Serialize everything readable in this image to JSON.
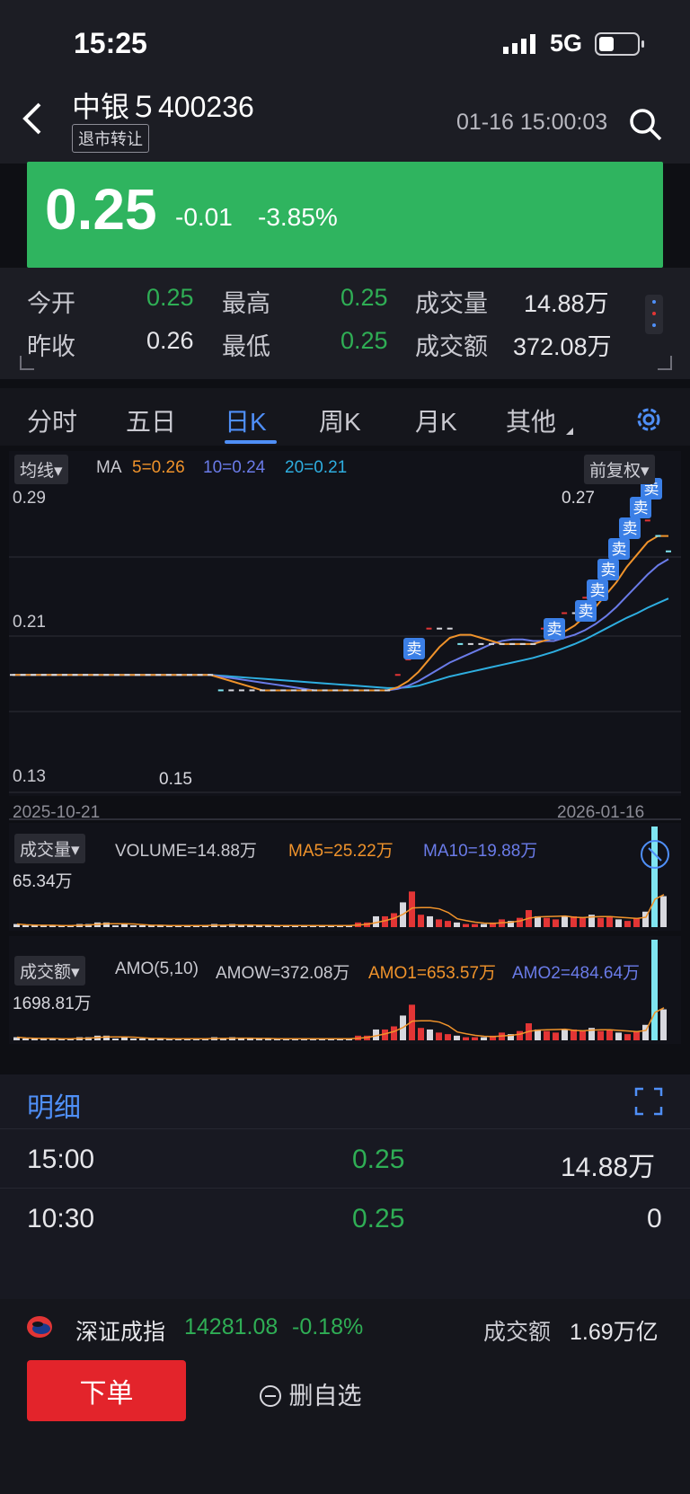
{
  "status": {
    "time": "15:25",
    "network": "5G"
  },
  "header": {
    "name": "中银５400236",
    "tag": "退市转让",
    "datetime": "01-16 15:00:03"
  },
  "price": {
    "last": "0.25",
    "change": "-0.01",
    "change_pct": "-3.85%"
  },
  "quote": {
    "open_label": "今开",
    "open": "0.25",
    "high_label": "最高",
    "high": "0.25",
    "vol_label": "成交量",
    "vol": "14.88万",
    "prev_label": "昨收",
    "prev": "0.26",
    "low_label": "最低",
    "low": "0.25",
    "amt_label": "成交额",
    "amt": "372.08万"
  },
  "tabs": [
    "分时",
    "五日",
    "日K",
    "周K",
    "月K",
    "其他"
  ],
  "active_tab": "日K",
  "kline": {
    "ma_dropdown": "均线",
    "ma_label": "MA",
    "ma5": "5=0.26",
    "ma10": "10=0.24",
    "ma20": "20=0.21",
    "adjust": "前复权",
    "y_top": "0.29",
    "y_mid": "0.21",
    "y_bot": "0.13",
    "max_label": "0.27",
    "min_label": "0.15",
    "date_start": "2025-10-21",
    "date_end": "2026-01-16",
    "sell_tag": "卖"
  },
  "volume": {
    "dropdown": "成交量",
    "text": "VOLUME=14.88万",
    "ma5": "MA5=25.22万",
    "ma10": "MA10=19.88万",
    "max": "65.34万"
  },
  "amount": {
    "dropdown": "成交额",
    "text": "AMO(5,10)",
    "amow": "AMOW=372.08万",
    "amo1": "AMO1=653.57万",
    "amo2": "AMO2=484.64万",
    "max": "1698.81万"
  },
  "detail": {
    "title": "明细",
    "rows": [
      {
        "time": "15:00",
        "price": "0.25",
        "vol": "14.88万"
      },
      {
        "time": "10:30",
        "price": "0.25",
        "vol": "0"
      }
    ]
  },
  "index": {
    "name": "深证成指",
    "value": "14281.08",
    "pct": "-0.18%",
    "amt_label": "成交额",
    "amt": "1.69万亿"
  },
  "actions": {
    "order": "下单",
    "remove_fav": "删自选"
  },
  "colors": {
    "up": "#e23535",
    "down": "#2fae55",
    "accent": "#4f8ff7",
    "ma5": "#f0932b",
    "ma10": "#6a7be8",
    "ma20": "#2eaee0",
    "flat": "#d8d8de",
    "cyan": "#7fe5f0"
  },
  "chart_data": {
    "type": "candlestick",
    "categories_start": "2025-10-21",
    "categories_end": "2026-01-16",
    "ylim": [
      0.13,
      0.29
    ],
    "close": [
      0.17,
      0.17,
      0.17,
      0.17,
      0.17,
      0.17,
      0.17,
      0.17,
      0.17,
      0.17,
      0.17,
      0.17,
      0.17,
      0.17,
      0.17,
      0.17,
      0.17,
      0.17,
      0.17,
      0.17,
      0.16,
      0.16,
      0.16,
      0.16,
      0.16,
      0.16,
      0.16,
      0.16,
      0.16,
      0.16,
      0.16,
      0.16,
      0.16,
      0.16,
      0.16,
      0.16,
      0.16,
      0.17,
      0.18,
      0.19,
      0.2,
      0.2,
      0.2,
      0.19,
      0.19,
      0.19,
      0.19,
      0.19,
      0.19,
      0.19,
      0.19,
      0.2,
      0.2,
      0.21,
      0.21,
      0.22,
      0.23,
      0.24,
      0.25,
      0.26,
      0.26,
      0.27,
      0.26,
      0.25
    ],
    "volume": [
      2,
      1,
      1,
      1,
      1,
      1,
      1,
      2,
      2,
      3,
      3,
      1,
      2,
      1,
      1,
      1,
      1,
      1,
      1,
      1,
      1,
      1,
      2,
      1,
      2,
      1,
      1,
      1,
      1,
      1,
      1,
      1,
      1,
      1,
      1,
      1,
      1,
      1,
      3,
      3,
      7,
      7,
      9,
      16,
      23,
      8,
      7,
      5,
      4,
      3,
      2,
      2,
      2,
      3,
      5,
      4,
      6,
      11,
      7,
      6,
      5,
      7,
      7,
      6,
      8,
      6,
      7,
      5,
      4,
      6,
      10,
      65,
      20
    ],
    "max_volume": "65.34万",
    "max_amount": "1698.81万"
  }
}
